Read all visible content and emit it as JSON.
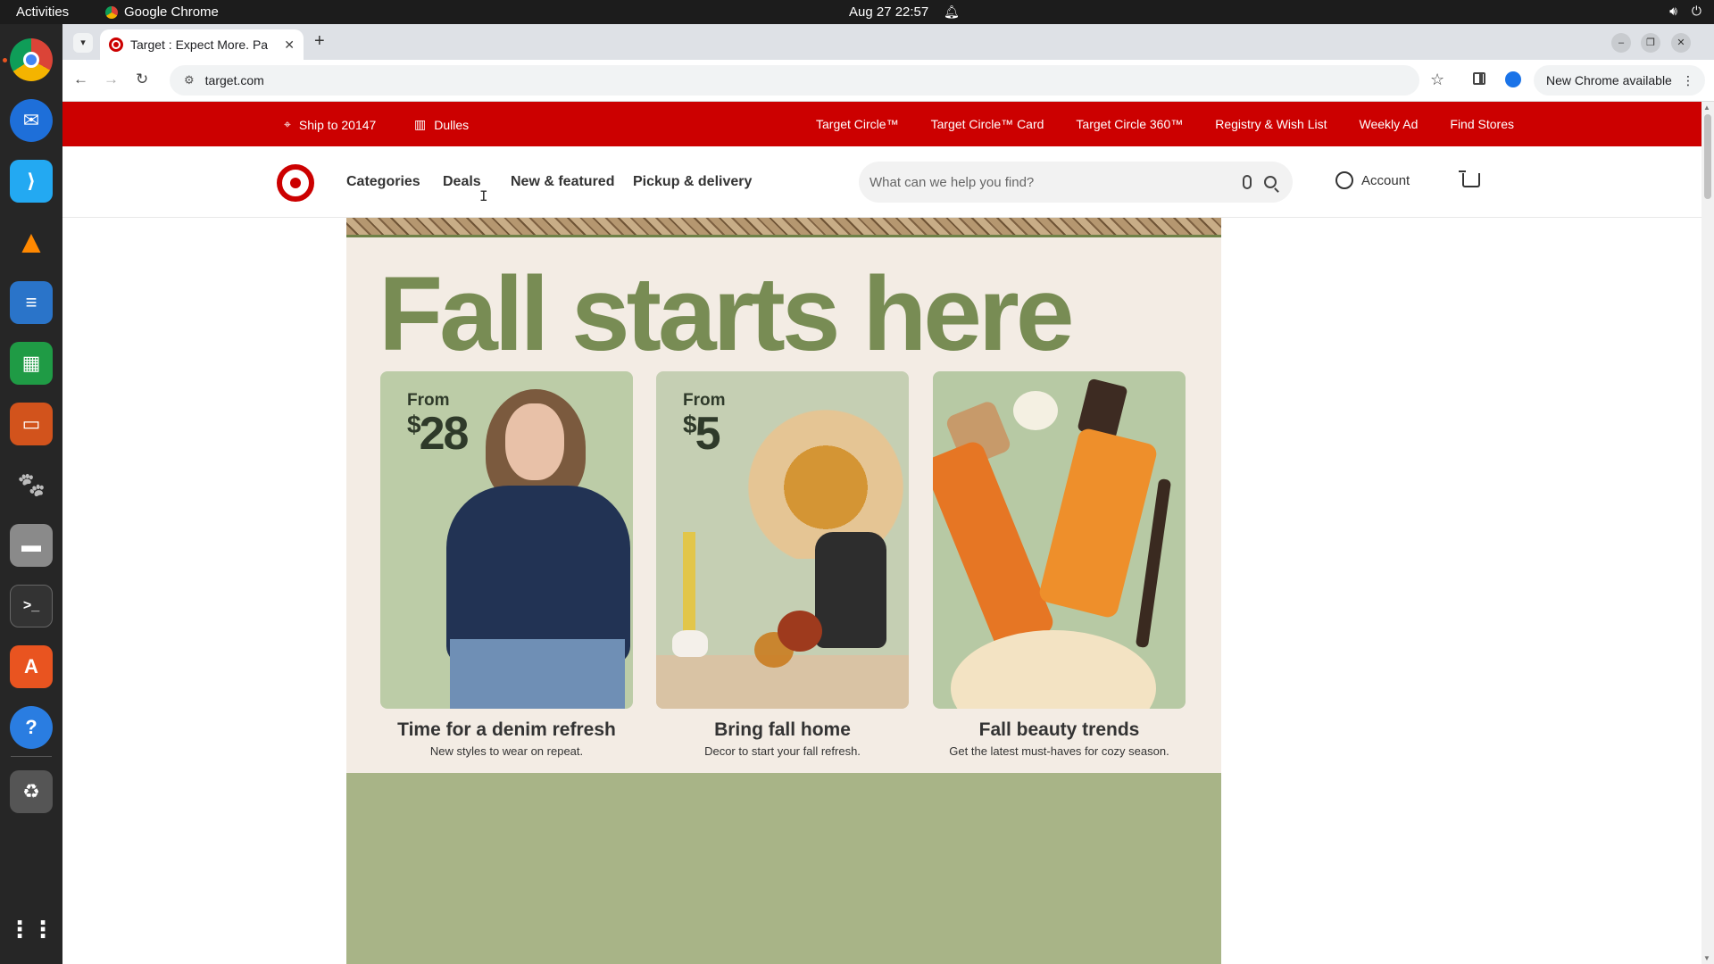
{
  "system": {
    "activities": "Activities",
    "app_name": "Google Chrome",
    "clock": "Aug 27  22:57"
  },
  "browser": {
    "tab_title": "Target : Expect More. Pa",
    "url": "target.com",
    "update_label": "New Chrome available"
  },
  "topbar": {
    "ship_to": "Ship to 20147",
    "store": "Dulles",
    "links": [
      "Target Circle™",
      "Target Circle™ Card",
      "Target Circle 360™",
      "Registry & Wish List",
      "Weekly Ad",
      "Find Stores"
    ]
  },
  "nav": {
    "categories": "Categories",
    "deals": "Deals",
    "new_featured": "New & featured",
    "pickup_delivery": "Pickup & delivery",
    "search_placeholder": "What can we help you find?",
    "account": "Account"
  },
  "hero": {
    "headline": "Fall starts here",
    "cards": [
      {
        "from": "From",
        "price": "28",
        "title": "Time for a denim refresh",
        "subtitle": "New styles to wear on repeat."
      },
      {
        "from": "From",
        "price": "5",
        "title": "Bring fall home",
        "subtitle": "Decor to start your fall refresh."
      },
      {
        "from": "",
        "price": "",
        "title": "Fall beauty trends",
        "subtitle": "Get the latest must-haves for cozy season."
      }
    ]
  },
  "colors": {
    "target_red": "#cc0000",
    "headline_green": "#788c54",
    "hero_bg": "#f3ece4"
  }
}
